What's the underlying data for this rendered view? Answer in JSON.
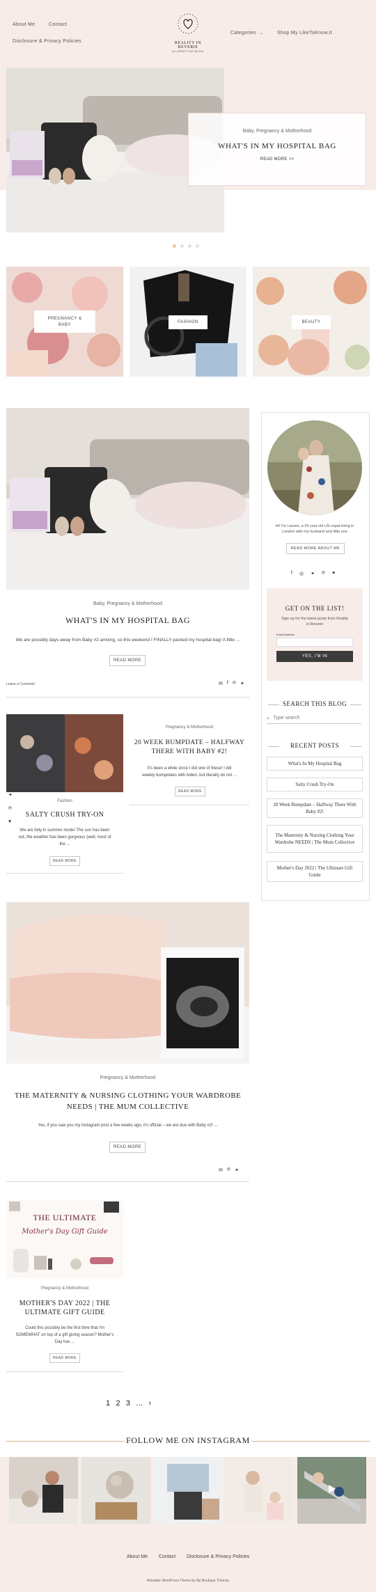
{
  "header": {
    "nav_left": [
      "About Me",
      "Contact",
      "Disclosure & Privacy Policies"
    ],
    "nav_right": [
      "Categories",
      "Shop My LikeToKnow.It"
    ],
    "logo_line1": "REALITY IN REVERIE",
    "logo_line2": "A LIFESTYLE BLOG"
  },
  "hero": {
    "category": "Baby, Pregnancy & Motherhood",
    "title": "WHAT'S IN MY HOSPITAL BAG",
    "read_more": "READ MORE >>",
    "slide_count": 4,
    "active_slide": 1
  },
  "tiles": [
    {
      "label_line1": "PREGNANCY &",
      "label_line2": "BABY"
    },
    {
      "label_line1": "FASHION",
      "label_line2": ""
    },
    {
      "label_line1": "BEAUTY",
      "label_line2": ""
    }
  ],
  "featured_post": {
    "category": "Baby, Pregnancy & Motherhood",
    "title": "WHAT'S IN MY HOSPITAL BAG",
    "excerpt": "We are possibly days away from Baby #2 arriving, so this weekend I FINALLY packed my hospital bag! A little ...",
    "button": "READ MORE",
    "comments": "Leave a Comment"
  },
  "grid_posts": [
    {
      "category": "Pregnancy & Motherhood",
      "title_line1": "20 WEEK BUMPDATE – HALFWAY",
      "title_line2": "THERE WITH BABY #2!",
      "excerpt_line1": "It's been a while since I did one of these! I did",
      "excerpt_line2": "weekly bumpdates with Aiden, but literally do not ...",
      "button": "READ MORE"
    },
    {
      "category": "Fashion",
      "title": "SALTY CRUSH TRY-ON",
      "excerpt_line1": "We are fully in summer mode! The sun has been",
      "excerpt_line2": "out, the weather has been gorgeous (well, most of",
      "excerpt_line3": "the ...",
      "button": "READ MORE"
    }
  ],
  "wide_post": {
    "category": "Pregnancy & Motherhood",
    "title_line1": "THE MATERNITY & NURSING CLOTHING YOUR WARDROBE",
    "title_line2": "NEEDS | THE MUM COLLECTIVE",
    "excerpt": "Yes, if you saw you my instagram post a few weeks ago, it's official – we are due with Baby #2! ...",
    "button": "READ MORE"
  },
  "last_post": {
    "category": "Pregnancy & Motherhood",
    "title_line1": "MOTHER'S DAY 2022 | THE",
    "title_line2": "ULTIMATE GIFT GUIDE",
    "excerpt_line1": "Could this possibly be the first time that I'm",
    "excerpt_line2": "SOMEWHAT on top of a gift giving season? Mother's",
    "excerpt_line3": "Day has ...",
    "button": "READ MORE",
    "image_text1": "THE ULTIMATE",
    "image_text2": "Mother's Day Gift Guide"
  },
  "sidebar": {
    "about_line1": "Hi! I'm Lauren, a 29 year old US expat living in",
    "about_line2": "London with my husband and little one",
    "about_button": "READ MORE ABOUT ME",
    "newsletter_title": "GET ON THE LIST!",
    "newsletter_sub_line1": "Sign up for the latest posts from Reality",
    "newsletter_sub_line2": "in Reverie",
    "email_label": "Email Address",
    "newsletter_button": "YES, I'M IN",
    "search_heading": "SEARCH THIS BLOG",
    "search_placeholder": "Type search",
    "recent_heading": "RECENT POSTS",
    "recent_posts": [
      "What's In My Hospital Bag",
      "Salty Crush Try-On",
      "20 Week Bumpdate – Halfway There With Baby #2!",
      "The Maternity & Nursing Clothing Your Wardrobe NEEDS | The Mum Collective",
      "Mother's Day 2022 | The Ultimate Gift Guide"
    ]
  },
  "pagination": [
    "1",
    "2",
    "3",
    "...",
    "›"
  ],
  "instagram": {
    "heading": "FOLLOW ME ON INSTAGRAM"
  },
  "footer": {
    "links": [
      "About Me",
      "Contact",
      "Disclosure & Privacy Policies"
    ],
    "credit": "Adorable WordPress Theme by My Boutique Themes"
  },
  "colors": {
    "blush": "#f8ece9",
    "accent_gold": "#d9b38a",
    "button_dark": "#3b3b3b"
  }
}
